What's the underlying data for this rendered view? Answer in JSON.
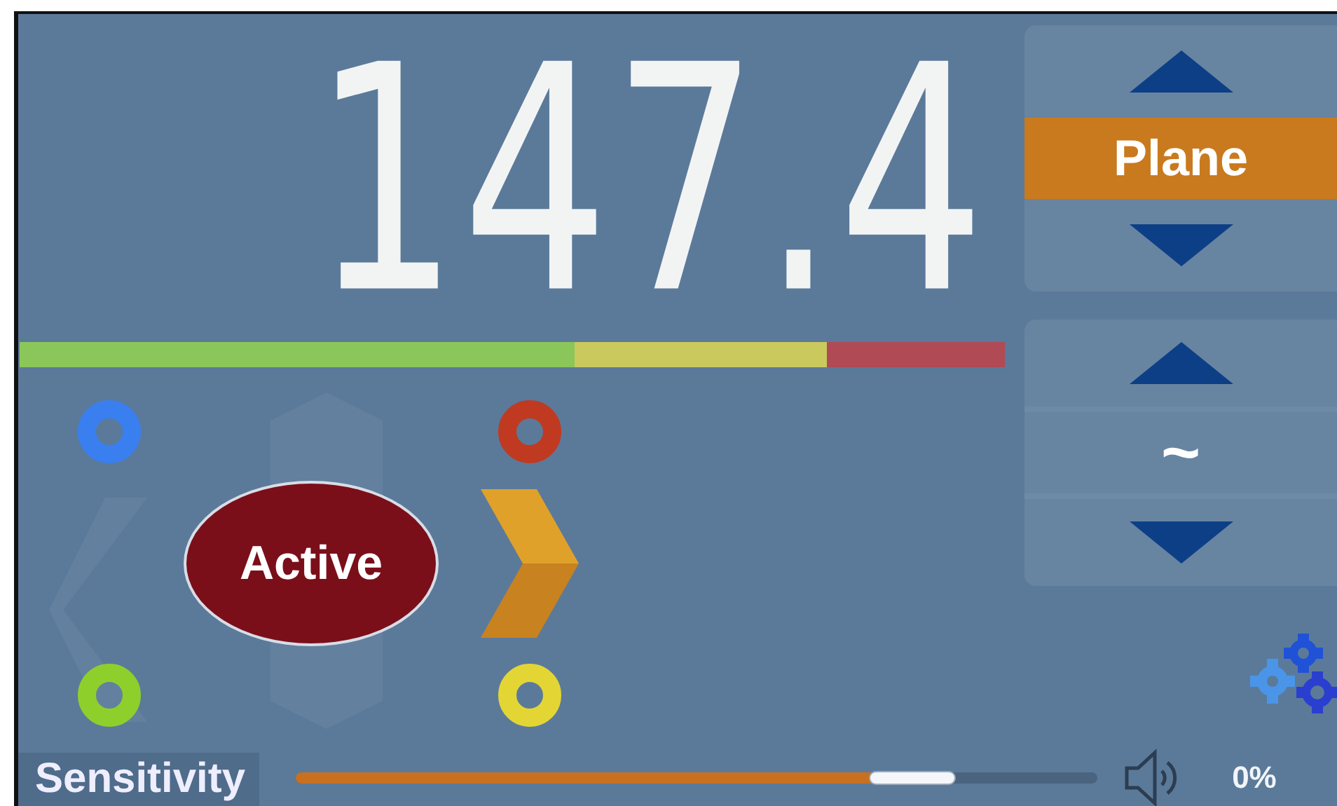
{
  "display": {
    "reading": "147.4"
  },
  "mode_selector": {
    "label": "Plane"
  },
  "filter_selector": {
    "label": "~"
  },
  "indicators": [
    {
      "color": "#3a7ff0"
    },
    {
      "color": "#c03a22"
    },
    {
      "color": "#8fcf2c"
    },
    {
      "color": "#e3d634"
    }
  ],
  "status": {
    "label": "Active"
  },
  "sensitivity": {
    "label": "Sensitivity",
    "level": 0.77
  },
  "volume": {
    "reading": "0%"
  }
}
